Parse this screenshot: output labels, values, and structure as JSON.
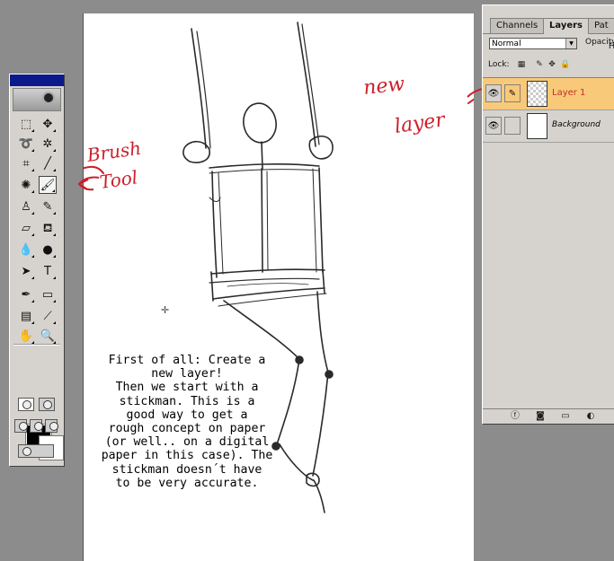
{
  "toolbox": {
    "tools": [
      {
        "name": "marquee-tool-icon",
        "glyph": "⬚"
      },
      {
        "name": "move-tool-icon",
        "glyph": "✥"
      },
      {
        "name": "lasso-tool-icon",
        "glyph": "➰"
      },
      {
        "name": "magic-wand-icon",
        "glyph": "✲"
      },
      {
        "name": "crop-tool-icon",
        "glyph": "⌗"
      },
      {
        "name": "slice-tool-icon",
        "glyph": "╱"
      },
      {
        "name": "healing-brush-icon",
        "glyph": "✺"
      },
      {
        "name": "brush-tool-icon",
        "glyph": "🖌"
      },
      {
        "name": "clone-stamp-icon",
        "glyph": "♙"
      },
      {
        "name": "history-brush-icon",
        "glyph": "✎"
      },
      {
        "name": "eraser-tool-icon",
        "glyph": "▱"
      },
      {
        "name": "paint-bucket-icon",
        "glyph": "⛾"
      },
      {
        "name": "blur-tool-icon",
        "glyph": "💧"
      },
      {
        "name": "dodge-tool-icon",
        "glyph": "●"
      },
      {
        "name": "path-select-icon",
        "glyph": "➤"
      },
      {
        "name": "type-tool-icon",
        "glyph": "T"
      },
      {
        "name": "pen-tool-icon",
        "glyph": "✒"
      },
      {
        "name": "shape-tool-icon",
        "glyph": "▭"
      },
      {
        "name": "notes-tool-icon",
        "glyph": "▤"
      },
      {
        "name": "eyedropper-icon",
        "glyph": "⟋"
      },
      {
        "name": "hand-tool-icon",
        "glyph": "✋"
      },
      {
        "name": "zoom-tool-icon",
        "glyph": "🔍"
      }
    ],
    "active_tool": "brush-tool-icon",
    "foreground_color": "#000000",
    "background_color": "#ffffff"
  },
  "canvas": {
    "caption": "First of all: Create a\nnew layer!\nThen we start with a\nstickman. This is a\ngood way to get a\nrough concept on paper\n(or well.. on a digital\npaper in this case). The\nstickman doesn´t have\nto be very accurate.",
    "annotations": {
      "brush_tool": "Brush Tool",
      "new_layer": "new layer"
    },
    "annotation_color": "#cc1f2a"
  },
  "layers_panel": {
    "tabs": [
      "Channels",
      "Layers",
      "Pat"
    ],
    "active_tab": "Layers",
    "blend_mode": "Normal",
    "opacity_label": "Opacity",
    "fill_label": "Fi",
    "lock_label": "Lock:",
    "layers": [
      {
        "name": "Layer 1",
        "selected": true
      },
      {
        "name": "Background",
        "selected": false
      }
    ],
    "selected_color": "#f9c97a"
  }
}
